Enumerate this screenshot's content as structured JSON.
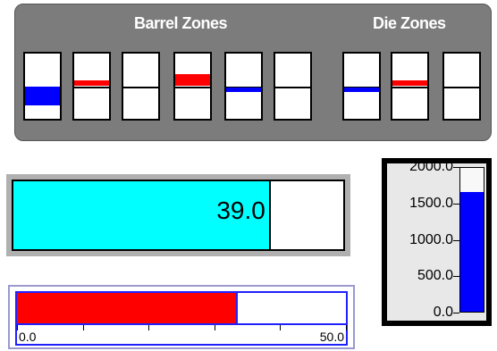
{
  "zones": {
    "barrel_title": "Barrel Zones",
    "die_title": "Die Zones",
    "barrel": [
      {
        "indicator": "fill-low",
        "color": "#0000ff"
      },
      {
        "indicator": "line-high",
        "color": "#ff0000"
      },
      {
        "indicator": "none",
        "color": ""
      },
      {
        "indicator": "band-high",
        "color": "#ff0000"
      },
      {
        "indicator": "line-mid",
        "color": "#0000ff"
      },
      {
        "indicator": "none",
        "color": ""
      }
    ],
    "die": [
      {
        "indicator": "line-mid",
        "color": "#0000ff"
      },
      {
        "indicator": "line-high",
        "color": "#ff0000"
      },
      {
        "indicator": "none",
        "color": ""
      }
    ]
  },
  "horizontal_bar": {
    "value_text": "39.0",
    "value": 39.0,
    "fraction": 0.78,
    "fill_color": "#00ffff"
  },
  "red_bar": {
    "min_label": "0.0",
    "max_label": "50.0",
    "fraction": 0.67,
    "fill_color": "#ff0000"
  },
  "vertical_gauge": {
    "labels": [
      "2000.0",
      "1500.0",
      "1000.0",
      "500.0",
      "0.0"
    ],
    "max": 2000,
    "value": 1650,
    "fill_color": "#0000ff"
  }
}
